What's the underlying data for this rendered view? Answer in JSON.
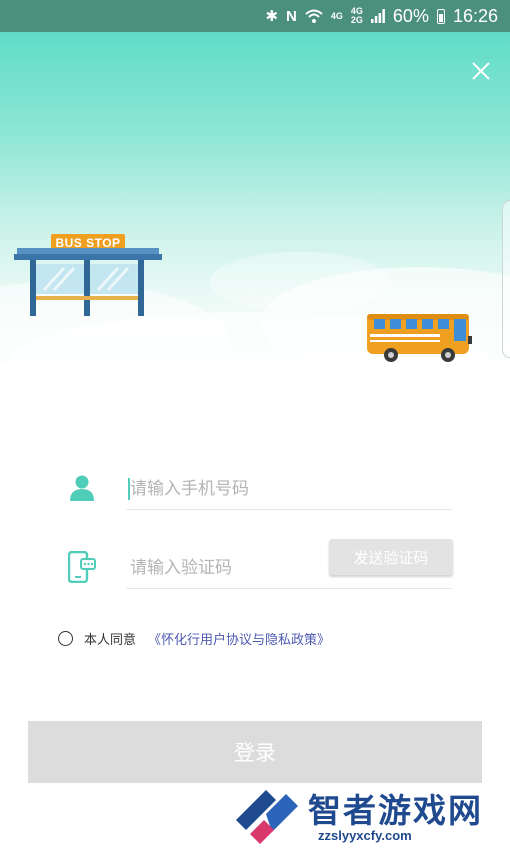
{
  "status_bar": {
    "network_top": "4G",
    "network_sub_top": "4G",
    "network_sub_bottom": "2G",
    "battery": "60%",
    "time": "16:26",
    "icons": [
      "bluetooth-icon",
      "nfc-icon",
      "wifi-icon",
      "signal-icon",
      "battery-icon"
    ]
  },
  "hero": {
    "sign_text": "BUS STOP",
    "close_icon": "close-icon"
  },
  "form": {
    "phone_placeholder": "请输入手机号码",
    "code_placeholder": "请输入验证码",
    "send_code_label": "发送验证码"
  },
  "agreement": {
    "prefix": "本人同意",
    "link": "《怀化行用户协议与隐私政策》",
    "checked": false
  },
  "login_label": "登录",
  "watermark": {
    "title": "智者游戏网",
    "url": "zzslyyxcfy.com"
  },
  "colors": {
    "accent": "#4fcdb9",
    "status_bar": "#4b8f7d",
    "link": "#4d5ab0",
    "button_disabled": "#dcdcdc",
    "watermark": "#1f4a8f"
  }
}
